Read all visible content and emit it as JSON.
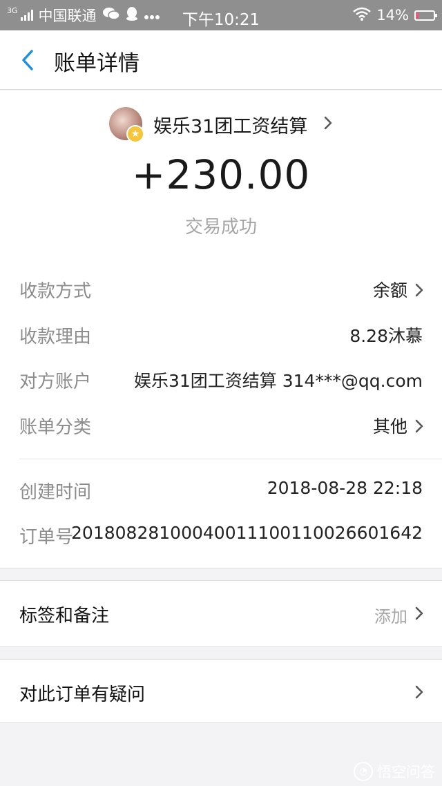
{
  "status_bar": {
    "network": "3G",
    "carrier": "中国联通",
    "time": "下午10:21",
    "battery_text": "14%",
    "battery_level": 0.14
  },
  "nav": {
    "title": "账单详情",
    "back_icon": "chevron-left-icon"
  },
  "transaction": {
    "merchant_name": "娱乐31团工资结算",
    "amount": "+230.00",
    "status": "交易成功"
  },
  "details": [
    {
      "label": "收款方式",
      "value": "余额",
      "chevron": true
    },
    {
      "label": "收款理由",
      "value": "8.28沐慕",
      "chevron": false
    },
    {
      "label": "对方账户",
      "value": "娱乐31团工资结算 314***@qq.com",
      "chevron": false
    },
    {
      "label": "账单分类",
      "value": "其他",
      "chevron": true
    }
  ],
  "meta": [
    {
      "label": "创建时间",
      "value": "2018-08-28 22:18"
    },
    {
      "label": "订单号",
      "value": "20180828100040011100110026601642"
    }
  ],
  "tags": {
    "label": "标签和备注",
    "action": "添加"
  },
  "question": {
    "label": "对此订单有疑问"
  },
  "watermark": {
    "text": "悟空问答"
  },
  "colors": {
    "accent": "#1e8fe1",
    "status_bar": "#8f8f8f",
    "battery_low": "#ff4e7b"
  }
}
